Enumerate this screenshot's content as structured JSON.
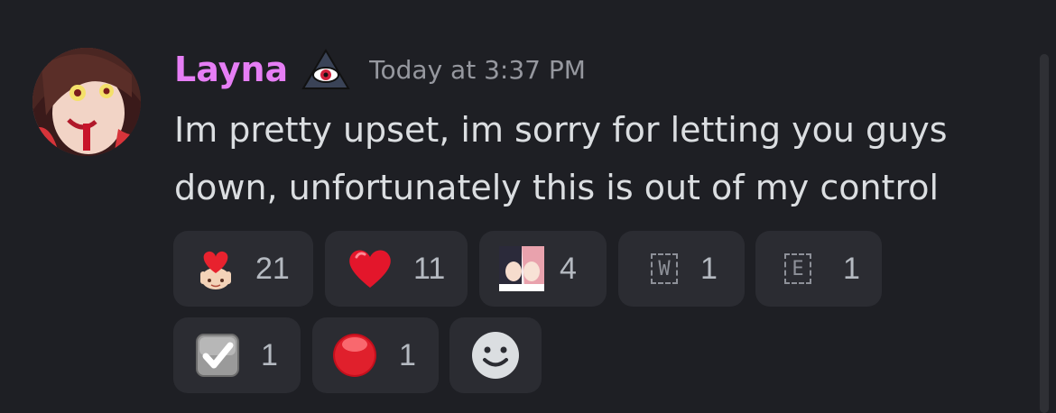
{
  "message": {
    "username": "Layna",
    "timestamp": "Today at 3:37 PM",
    "content": "Im pretty upset, im sorry for letting you guys down, unfortunately this is out of my control",
    "role_icon": "eye-triangle-icon",
    "username_color": "#e67ef5"
  },
  "reactions": [
    {
      "emoji": "heart-hug-emoji",
      "count": "21"
    },
    {
      "emoji": "red-heart-emoji",
      "count": "11"
    },
    {
      "emoji": "anime-couple-emoji",
      "count": "4"
    },
    {
      "emoji": "regional-indicator-w",
      "letter": "W",
      "count": "1"
    },
    {
      "emoji": "regional-indicator-e",
      "letter": "E",
      "count": "1"
    },
    {
      "emoji": "check-box-emoji",
      "count": "1"
    },
    {
      "emoji": "red-circle-emoji",
      "count": "1"
    }
  ],
  "add_reaction": {
    "icon": "smiley-add-reaction-icon"
  }
}
